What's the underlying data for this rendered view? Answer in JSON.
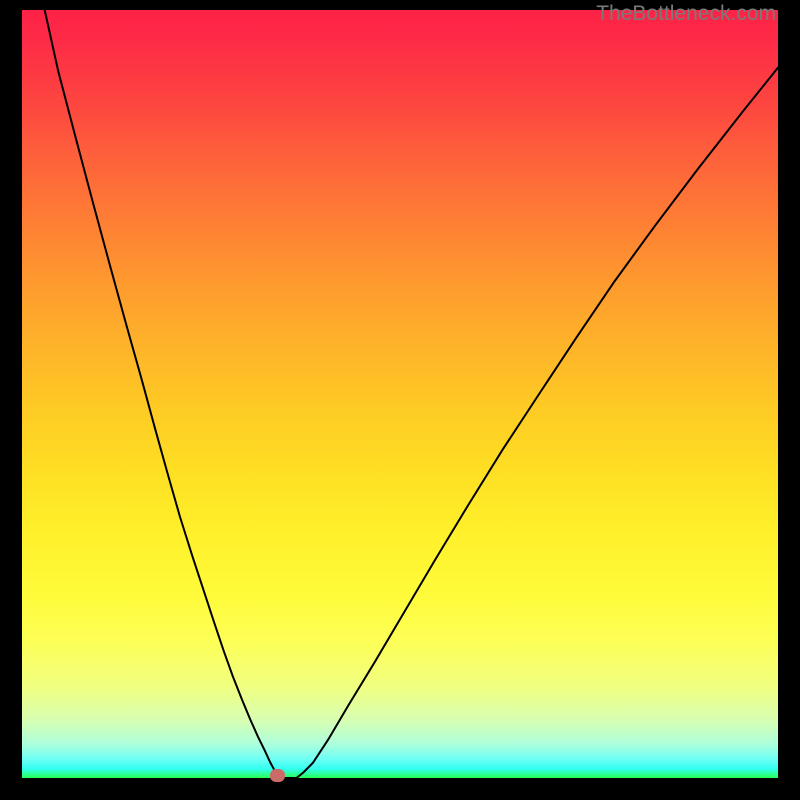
{
  "watermark": "TheBottleneck.com",
  "chart_data": {
    "type": "line",
    "title": "",
    "xlabel": "",
    "ylabel": "",
    "xlim": [
      0,
      100
    ],
    "ylim": [
      0,
      100
    ],
    "grid": false,
    "x": [
      3.0,
      4.8,
      7.2,
      9.5,
      11.7,
      13.8,
      15.8,
      17.6,
      19.3,
      20.9,
      22.5,
      24.0,
      25.4,
      26.7,
      27.9,
      29.1,
      30.2,
      31.2,
      32.1,
      32.8,
      33.4,
      33.7,
      34.0,
      36.3,
      37.2,
      38.5,
      40.5,
      43.2,
      46.6,
      50.5,
      54.7,
      59.0,
      63.6,
      68.4,
      73.3,
      78.4,
      83.8,
      89.4,
      95.2,
      100.0
    ],
    "y": [
      100.0,
      92.0,
      83.0,
      74.5,
      66.5,
      59.0,
      52.0,
      45.5,
      39.5,
      34.0,
      29.0,
      24.5,
      20.3,
      16.5,
      13.2,
      10.2,
      7.6,
      5.4,
      3.6,
      2.1,
      1.0,
      0.3,
      0.0,
      0.0,
      0.7,
      2.0,
      5.0,
      9.5,
      15.0,
      21.5,
      28.5,
      35.5,
      42.8,
      50.0,
      57.3,
      64.7,
      72.0,
      79.3,
      86.6,
      92.5
    ],
    "marker": {
      "x": 33.7,
      "y": 0
    },
    "gradient_stops": [
      {
        "pos": 0.0,
        "color": "#fd2246"
      },
      {
        "pos": 0.5,
        "color": "#fecb24"
      },
      {
        "pos": 0.85,
        "color": "#f1ff80"
      },
      {
        "pos": 1.0,
        "color": "#27ff51"
      }
    ]
  }
}
